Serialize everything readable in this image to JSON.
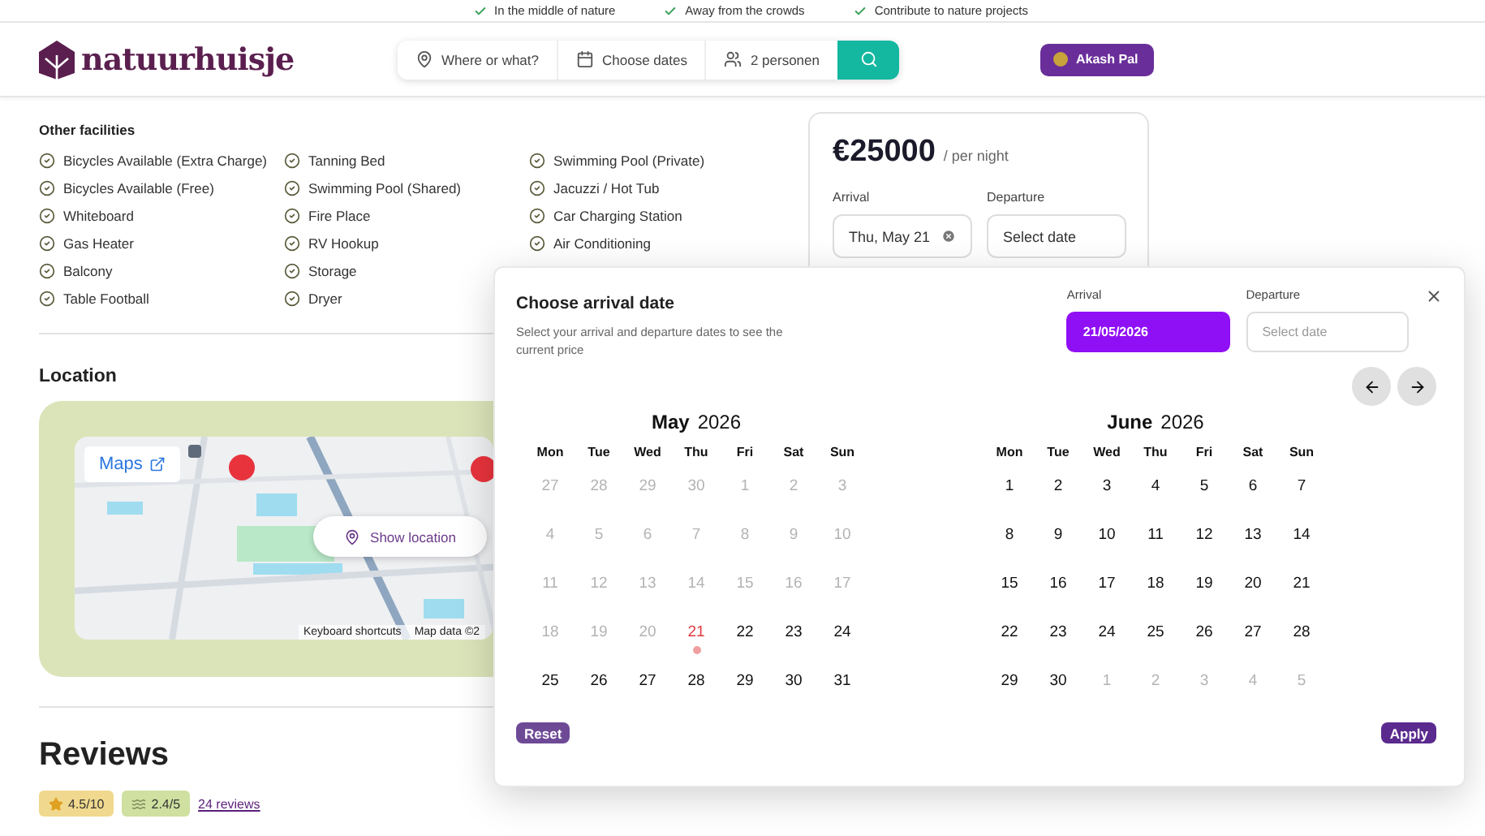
{
  "top_bar": {
    "perks": [
      "In the middle of nature",
      "Away from the crowds",
      "Contribute to nature projects"
    ]
  },
  "header": {
    "logo": "natuurhuisje",
    "search": {
      "location_placeholder": "Where or what?",
      "dates": "Choose dates",
      "guests": "2 personen"
    },
    "user": {
      "name": "Akash Pal"
    }
  },
  "facilities": {
    "title": "Other facilities",
    "columns": [
      [
        "Bicycles Available (Extra Charge)",
        "Bicycles Available (Free)",
        "Whiteboard",
        "Gas Heater",
        "Balcony",
        "Table Football"
      ],
      [
        "Tanning Bed",
        "Swimming Pool (Shared)",
        "Fire Place",
        "RV Hookup",
        "Storage",
        "Dryer"
      ],
      [
        "Swimming Pool (Private)",
        "Jacuzzi / Hot Tub",
        "Car Charging Station",
        "Air Conditioning"
      ]
    ]
  },
  "location": {
    "title": "Location",
    "map": {
      "kind": "picture",
      "maps_link": "Maps",
      "show_location": "Show location",
      "attribution": [
        "Keyboard shortcuts",
        "Map data ©2"
      ]
    }
  },
  "reviews": {
    "title": "Reviews",
    "rating": "4.5/10",
    "eco_rating": "2.4/5",
    "count_link": "24 reviews"
  },
  "booking": {
    "price": "€25000",
    "unit": "/ per night",
    "arrival_label": "Arrival",
    "arrival_value": "Thu, May 21",
    "departure_label": "Departure",
    "departure_placeholder": "Select date"
  },
  "date_picker": {
    "title": "Choose arrival date",
    "subtitle": "Select your arrival and departure dates to see the current price",
    "arrival_label": "Arrival",
    "arrival_value": "21/05/2026",
    "departure_label": "Departure",
    "departure_placeholder": "Select date",
    "reset": "Reset",
    "apply": "Apply",
    "months": [
      {
        "month": "May",
        "year": "2026",
        "weekdays": [
          "Mon",
          "Tue",
          "Wed",
          "Thu",
          "Fri",
          "Sat",
          "Sun"
        ],
        "weeks": [
          [
            {
              "label": "27",
              "disabled": true,
              "selected": false
            },
            {
              "label": "28",
              "disabled": true,
              "selected": false
            },
            {
              "label": "29",
              "disabled": true,
              "selected": false
            },
            {
              "label": "30",
              "disabled": true,
              "selected": false
            },
            {
              "label": "1",
              "disabled": true,
              "selected": false
            },
            {
              "label": "2",
              "disabled": true,
              "selected": false
            },
            {
              "label": "3",
              "disabled": true,
              "selected": false
            }
          ],
          [
            {
              "label": "4",
              "disabled": true,
              "selected": false
            },
            {
              "label": "5",
              "disabled": true,
              "selected": false
            },
            {
              "label": "6",
              "disabled": true,
              "selected": false
            },
            {
              "label": "7",
              "disabled": true,
              "selected": false
            },
            {
              "label": "8",
              "disabled": true,
              "selected": false
            },
            {
              "label": "9",
              "disabled": true,
              "selected": false
            },
            {
              "label": "10",
              "disabled": true,
              "selected": false
            }
          ],
          [
            {
              "label": "11",
              "disabled": true,
              "selected": false
            },
            {
              "label": "12",
              "disabled": true,
              "selected": false
            },
            {
              "label": "13",
              "disabled": true,
              "selected": false
            },
            {
              "label": "14",
              "disabled": true,
              "selected": false
            },
            {
              "label": "15",
              "disabled": true,
              "selected": false
            },
            {
              "label": "16",
              "disabled": true,
              "selected": false
            },
            {
              "label": "17",
              "disabled": true,
              "selected": false
            }
          ],
          [
            {
              "label": "18",
              "disabled": true,
              "selected": false
            },
            {
              "label": "19",
              "disabled": true,
              "selected": false
            },
            {
              "label": "20",
              "disabled": true,
              "selected": false
            },
            {
              "label": "21",
              "disabled": false,
              "selected": true
            },
            {
              "label": "22",
              "disabled": false,
              "selected": false
            },
            {
              "label": "23",
              "disabled": false,
              "selected": false
            },
            {
              "label": "24",
              "disabled": false,
              "selected": false
            }
          ],
          [
            {
              "label": "25",
              "disabled": false,
              "selected": false
            },
            {
              "label": "26",
              "disabled": false,
              "selected": false
            },
            {
              "label": "27",
              "disabled": false,
              "selected": false
            },
            {
              "label": "28",
              "disabled": false,
              "selected": false
            },
            {
              "label": "29",
              "disabled": false,
              "selected": false
            },
            {
              "label": "30",
              "disabled": false,
              "selected": false
            },
            {
              "label": "31",
              "disabled": false,
              "selected": false
            }
          ]
        ]
      },
      {
        "month": "June",
        "year": "2026",
        "weekdays": [
          "Mon",
          "Tue",
          "Wed",
          "Thu",
          "Fri",
          "Sat",
          "Sun"
        ],
        "weeks": [
          [
            {
              "label": "1",
              "disabled": false,
              "selected": false
            },
            {
              "label": "2",
              "disabled": false,
              "selected": false
            },
            {
              "label": "3",
              "disabled": false,
              "selected": false
            },
            {
              "label": "4",
              "disabled": false,
              "selected": false
            },
            {
              "label": "5",
              "disabled": false,
              "selected": false
            },
            {
              "label": "6",
              "disabled": false,
              "selected": false
            },
            {
              "label": "7",
              "disabled": false,
              "selected": false
            }
          ],
          [
            {
              "label": "8",
              "disabled": false,
              "selected": false
            },
            {
              "label": "9",
              "disabled": false,
              "selected": false
            },
            {
              "label": "10",
              "disabled": false,
              "selected": false
            },
            {
              "label": "11",
              "disabled": false,
              "selected": false
            },
            {
              "label": "12",
              "disabled": false,
              "selected": false
            },
            {
              "label": "13",
              "disabled": false,
              "selected": false
            },
            {
              "label": "14",
              "disabled": false,
              "selected": false
            }
          ],
          [
            {
              "label": "15",
              "disabled": false,
              "selected": false
            },
            {
              "label": "16",
              "disabled": false,
              "selected": false
            },
            {
              "label": "17",
              "disabled": false,
              "selected": false
            },
            {
              "label": "18",
              "disabled": false,
              "selected": false
            },
            {
              "label": "19",
              "disabled": false,
              "selected": false
            },
            {
              "label": "20",
              "disabled": false,
              "selected": false
            },
            {
              "label": "21",
              "disabled": false,
              "selected": false
            }
          ],
          [
            {
              "label": "22",
              "disabled": false,
              "selected": false
            },
            {
              "label": "23",
              "disabled": false,
              "selected": false
            },
            {
              "label": "24",
              "disabled": false,
              "selected": false
            },
            {
              "label": "25",
              "disabled": false,
              "selected": false
            },
            {
              "label": "26",
              "disabled": false,
              "selected": false
            },
            {
              "label": "27",
              "disabled": false,
              "selected": false
            },
            {
              "label": "28",
              "disabled": false,
              "selected": false
            }
          ],
          [
            {
              "label": "29",
              "disabled": false,
              "selected": false
            },
            {
              "label": "30",
              "disabled": false,
              "selected": false
            },
            {
              "label": "1",
              "disabled": true,
              "selected": false
            },
            {
              "label": "2",
              "disabled": true,
              "selected": false
            },
            {
              "label": "3",
              "disabled": true,
              "selected": false
            },
            {
              "label": "4",
              "disabled": true,
              "selected": false
            },
            {
              "label": "5",
              "disabled": true,
              "selected": false
            }
          ]
        ]
      }
    ]
  }
}
